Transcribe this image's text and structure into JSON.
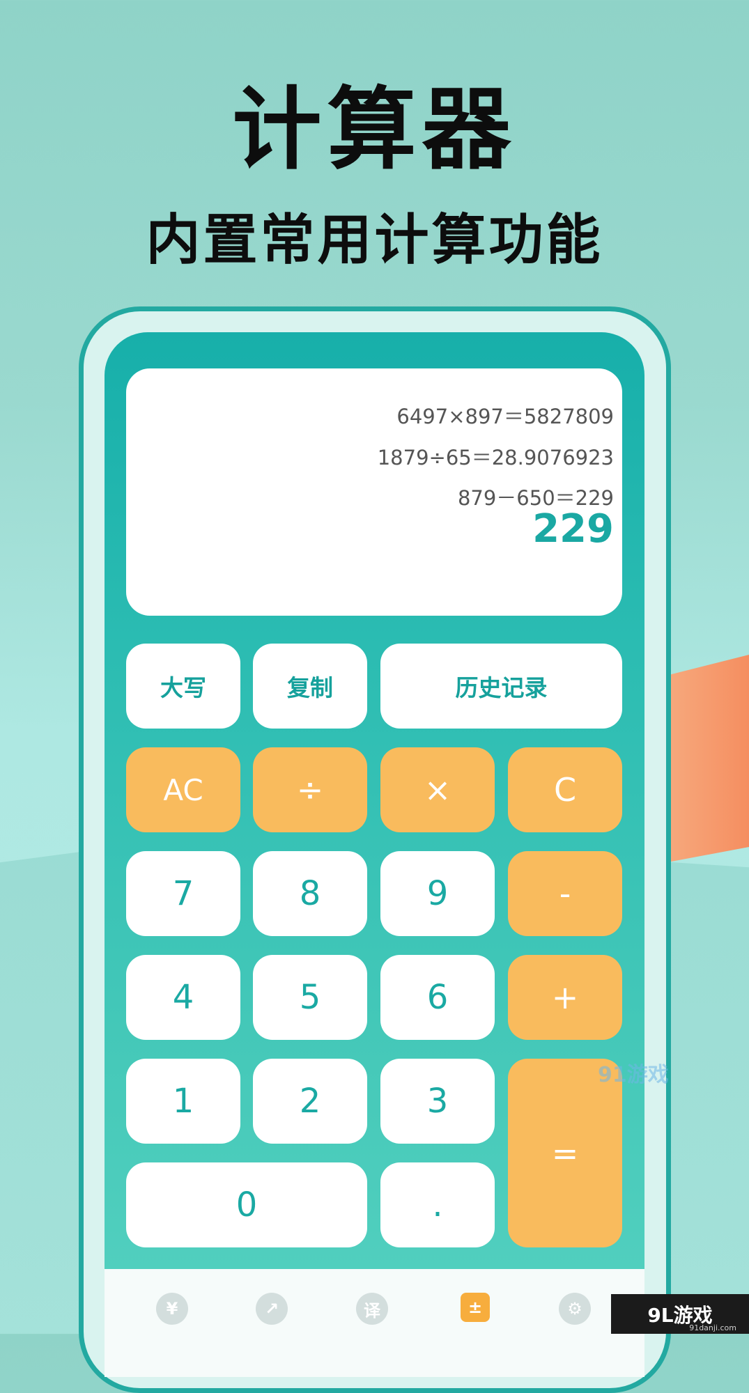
{
  "headline": {
    "title": "计算器",
    "subtitle": "内置常用计算功能"
  },
  "display": {
    "history": [
      "6497×897＝5827809",
      "1879÷65＝28.9076923",
      "879－650＝229"
    ],
    "result": "229"
  },
  "function_buttons": {
    "uppercase": "大写",
    "copy": "复制",
    "history": "历史记录"
  },
  "keys": {
    "ac": "AC",
    "divide": "÷",
    "multiply": "×",
    "clear": "C",
    "minus": "-",
    "plus": "+",
    "equals": "=",
    "decimal": ".",
    "d0": "0",
    "d1": "1",
    "d2": "2",
    "d3": "3",
    "d4": "4",
    "d5": "5",
    "d6": "6",
    "d7": "7",
    "d8": "8",
    "d9": "9"
  },
  "bottom_nav": {
    "items": [
      {
        "icon": "currency-icon",
        "glyph": "¥"
      },
      {
        "icon": "chart-icon",
        "glyph": "↗"
      },
      {
        "icon": "translate-icon",
        "glyph": "译"
      },
      {
        "icon": "calculator-icon",
        "glyph": "±"
      },
      {
        "icon": "settings-icon",
        "glyph": "⚙"
      }
    ],
    "active_index": 3
  },
  "watermark": {
    "middle": "91游戏",
    "corner": "9L游戏",
    "corner_sub": "91danji.com"
  },
  "colors": {
    "accent_teal": "#1aa8a3",
    "key_orange": "#f9bb5d",
    "nav_active": "#f7ad3d"
  }
}
